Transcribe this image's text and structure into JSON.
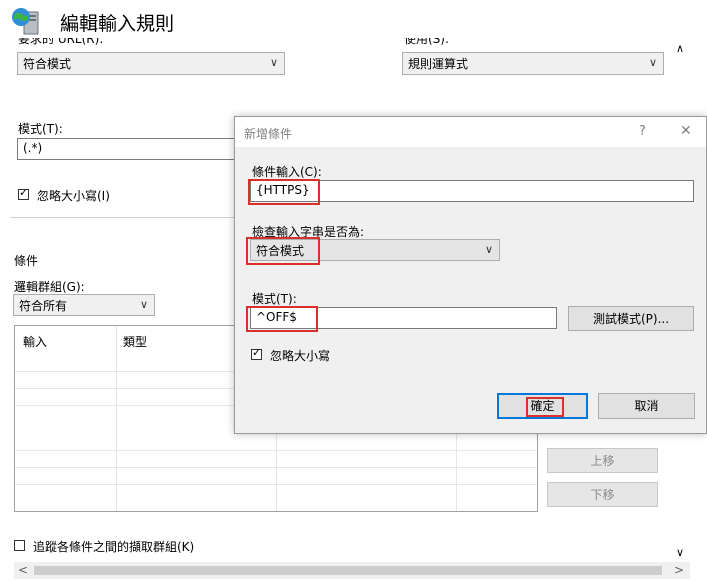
{
  "window": {
    "title": "編輯輸入規則",
    "icon": "globe-server-icon"
  },
  "background": {
    "requested_url_label": "要求的 URL(R):",
    "requested_url_value": "符合模式",
    "using_label": "使用(S):",
    "using_value": "規則運算式",
    "pattern_label": "模式(T):",
    "pattern_value": "(.*)",
    "ignore_case_label": "忽略大小寫(I)",
    "conditions_section": "條件",
    "logical_group_label": "邏輯群組(G):",
    "logical_group_value": "符合所有",
    "table_headers": [
      "輸入",
      "類型"
    ],
    "move_up": "上移",
    "move_down": "下移",
    "track_groups_label": "追蹤各條件之間的擷取群組(K)"
  },
  "dialog": {
    "title": "新增條件",
    "help": "?",
    "close": "✕",
    "condition_input_label": "條件輸入(C):",
    "condition_input_value": "{HTTPS}",
    "check_label": "檢查輸入字串是否為:",
    "check_value": "符合模式",
    "pattern_label": "模式(T):",
    "pattern_value": "^OFF$",
    "test_pattern_button": "測試模式(P)...",
    "ignore_case_label": "忽略大小寫",
    "ok_button": "確定",
    "cancel_button": "取消"
  },
  "colors": {
    "highlight": "#d9302c",
    "focus": "#0078d7"
  }
}
